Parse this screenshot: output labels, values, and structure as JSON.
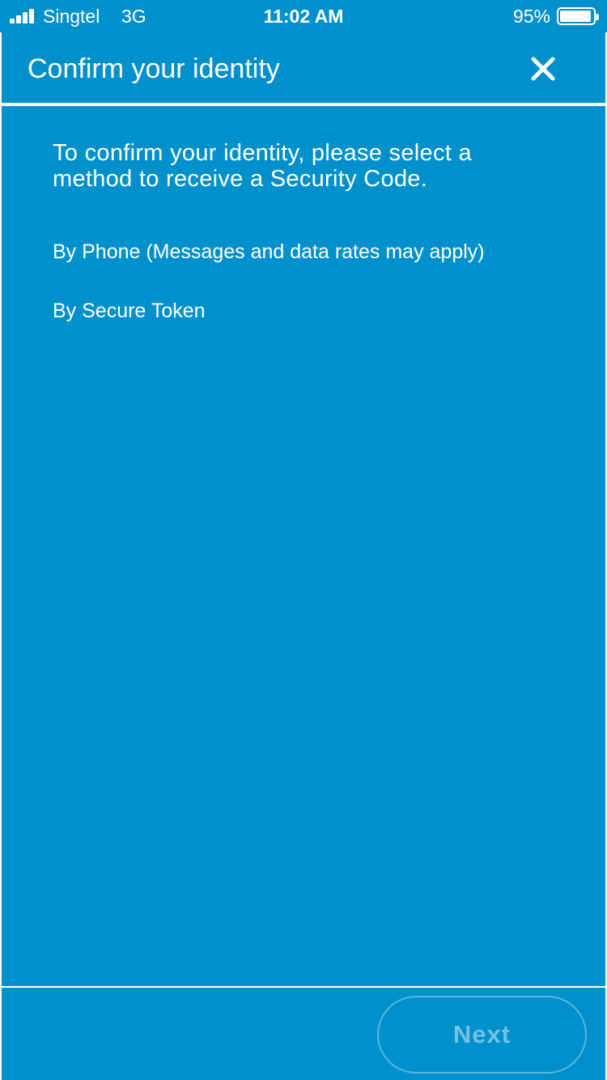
{
  "status_bar": {
    "carrier": "Singtel",
    "network": "3G",
    "time": "11:02 AM",
    "battery": "95%",
    "battery_level": 0.95,
    "signal_icon": "signal-bars-icon",
    "battery_icon": "battery-icon"
  },
  "header": {
    "title": "Confirm your identity",
    "close_icon": "close-icon"
  },
  "content": {
    "intro": "To confirm your identity, please select a method to receive a Security Code.",
    "options": [
      {
        "label": "By Phone (Messages and data rates may apply)"
      },
      {
        "label": "By Secure Token"
      }
    ]
  },
  "footer": {
    "next_label": "Next",
    "next_enabled": false
  },
  "colors": {
    "background": "#0090cc",
    "text": "#ffffff",
    "divider": "#ffffff"
  }
}
